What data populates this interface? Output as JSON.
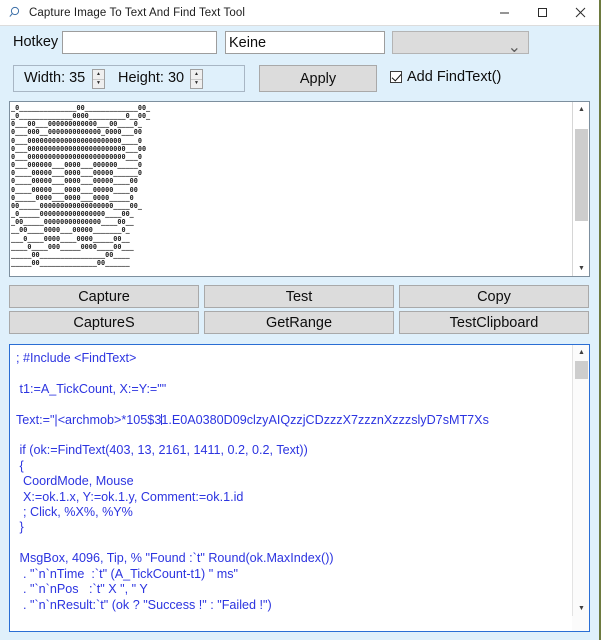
{
  "window": {
    "title": "Capture Image To Text And Find Text Tool",
    "icon": "magnifier-icon",
    "minimize_label": "—",
    "maximize_label": "▫",
    "close_label": "✕"
  },
  "hotkey_row": {
    "label": "Hotkey",
    "hotkey_value": "",
    "hotkey_placeholder": "",
    "keine_value": "Keine",
    "keine_placeholder": "",
    "combo_value": "",
    "combo_arrow": "⌄"
  },
  "size_row": {
    "width_label": "Width: 35",
    "height_label": "Height: 30",
    "apply_label": "Apply",
    "checkbox_label": "Add FindText()",
    "checkbox_checked": true,
    "spin_up": "▲",
    "spin_down": "▼"
  },
  "art": {
    "lines": [
      "_0______________00_____________00_",
      "_0_____________0000_________0__00_",
      "0___00___000000000000___00____0_",
      "0___000__0000000000000_0000___00",
      "0___00000000000000000000000____0",
      "0___000000000000000000000000___00",
      "0___000000000000000000000000___0",
      "0___000000___0000___000000_____0",
      "0____00000___0000___00000______0",
      "0____00000___0000___00000____00",
      "0____00000___0000___00000____00",
      "0_____0000___0000___0000_____0",
      "00_____000000000000000000____00_",
      "_0_____0000000000000000____00_",
      "_00_____00000000000000____00__",
      "__00____0000___00000_______0_",
      "___0____0000____0000_____00__",
      "____0____000_____0000____00___",
      "_____00________________00____",
      "_____00______________00______"
    ],
    "scroll_thumb_top_pct": 8,
    "scroll_thumb_height_pct": 64
  },
  "buttons": [
    {
      "label": "Capture",
      "name": "capture-button"
    },
    {
      "label": "Test",
      "name": "test-button"
    },
    {
      "label": "Copy",
      "name": "copy-button"
    },
    {
      "label": "CaptureS",
      "name": "captures-button"
    },
    {
      "label": "GetRange",
      "name": "getrange-button"
    },
    {
      "label": "TestClipboard",
      "name": "testclipboard-button"
    }
  ],
  "code": {
    "before_caret": "; #Include <FindText>\n\n t1:=A_TickCount, X:=Y:=\"\"\n\nText:=\"|<archmob>*105$3",
    "after_caret": "1.E0A0380D09clzyAIQzzjCDzzzX7zzznXzzzslyD7sMT7Xs\n\n if (ok:=FindText(403, 13, 2161, 1411, 0.2, 0.2, Text))\n {\n  CoordMode, Mouse\n  X:=ok.1.x, Y:=ok.1.y, Comment:=ok.1.id\n  ; Click, %X%, %Y%\n }\n\n MsgBox, 4096, Tip, % \"Found :`t\" Round(ok.MaxIndex())\n  . \"`n`nTime  :`t\" (A_TickCount-t1) \" ms\"\n  . \"`n`nPos   :`t\" X \", \" Y\n  . \"`n`nResult:`t\" (ok ? \"Success !\" : \"Failed !\")"
  },
  "scrollbar": {
    "up_arrow": "▲",
    "down_arrow": "▼"
  },
  "colors": {
    "window_background": "#dff0fb",
    "code_text": "#2c34e0",
    "code_border": "#2a6ed4",
    "button_face": "#dcdcdc"
  }
}
